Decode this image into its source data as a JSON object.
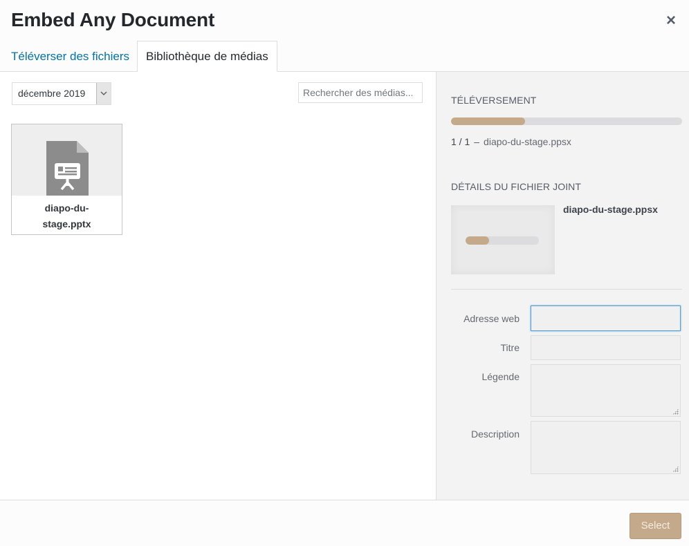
{
  "modal": {
    "title": "Embed Any Document",
    "close_icon": "×"
  },
  "tabs": [
    {
      "label": "Téléverser des fichiers",
      "active": false
    },
    {
      "label": "Bibliothèque de médias",
      "active": true
    }
  ],
  "toolbar": {
    "date_filter": "décembre 2019",
    "search_placeholder": "Rechercher des médias..."
  },
  "attachments": [
    {
      "filename": "diapo-du-stage.pptx",
      "icon": "presentation-file-icon"
    }
  ],
  "sidebar": {
    "upload_heading": "TÉLÉVERSEMENT",
    "upload_progress": 0.32,
    "upload_count": "1 / 1",
    "upload_separator": "–",
    "upload_filename": "diapo-du-stage.ppsx",
    "details_heading": "DÉTAILS DU FICHIER JOINT",
    "details_filename": "diapo-du-stage.ppsx",
    "preview_progress": 0.32,
    "fields": {
      "url_label": "Adresse web",
      "url_value": "",
      "title_label": "Titre",
      "title_value": "",
      "caption_label": "Légende",
      "caption_value": "",
      "description_label": "Description",
      "description_value": ""
    }
  },
  "footer": {
    "select_label": "Select"
  },
  "colors": {
    "accent": "#c5a98b",
    "link": "#0073aa"
  }
}
